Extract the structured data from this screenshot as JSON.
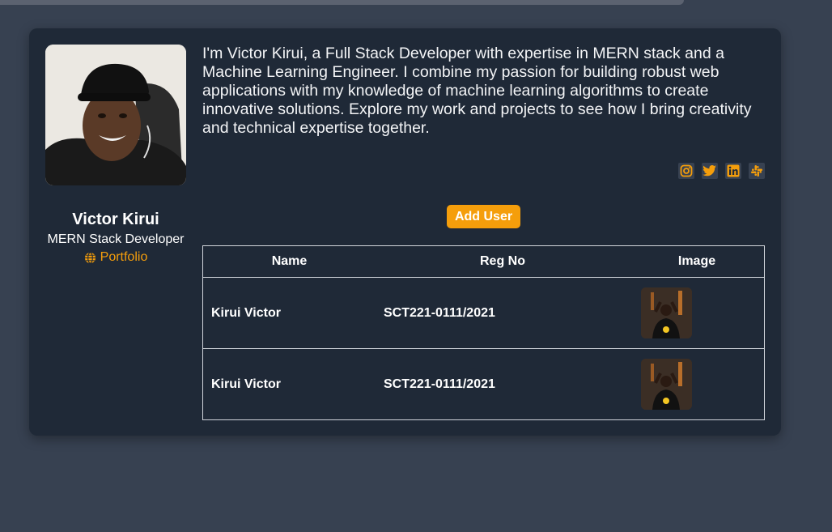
{
  "profile": {
    "name": "Victor Kirui",
    "role": "MERN Stack Developer",
    "portfolio_label": "Portfolio",
    "avatar_icon": "person-photo"
  },
  "bio": "I'm Victor Kirui, a Full Stack Developer with expertise in MERN stack and a Machine Learning Engineer. I combine my passion for building robust web applications with my knowledge of machine learning algorithms to create innovative solutions. Explore my work and projects to see how I bring creativity and technical expertise together.",
  "socials": [
    {
      "icon": "instagram-icon"
    },
    {
      "icon": "twitter-icon"
    },
    {
      "icon": "linkedin-icon"
    },
    {
      "icon": "slack-icon"
    }
  ],
  "add_user_label": "Add User",
  "table": {
    "headers": [
      "Name",
      "Reg No",
      "Image"
    ],
    "rows": [
      {
        "name": "Kirui Victor",
        "reg_no": "SCT221-0111/2021"
      },
      {
        "name": "Kirui Victor",
        "reg_no": "SCT221-0111/2021"
      }
    ]
  },
  "colors": {
    "accent": "#f59e0b",
    "card": "#1f2937",
    "background": "#374151"
  }
}
